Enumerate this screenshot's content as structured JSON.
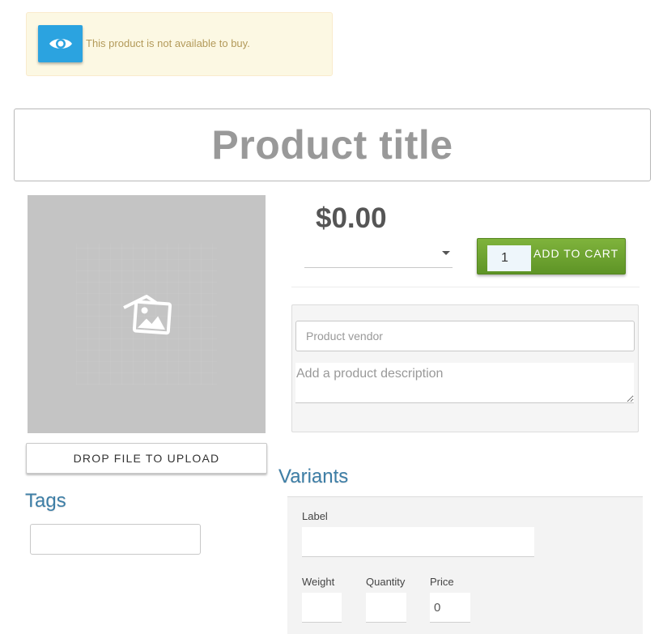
{
  "alert": {
    "icon": "eye-icon",
    "message": "This product is not available to buy."
  },
  "product": {
    "title": "Product title",
    "price": "$0.00",
    "vendor_placeholder": "Product vendor",
    "description_placeholder": "Add a product description"
  },
  "image": {
    "icon": "image-placeholder-icon",
    "upload_label": "DROP FILE TO UPLOAD"
  },
  "cart": {
    "quantity": "1",
    "button_label": "ADD TO CART"
  },
  "tags": {
    "heading": "Tags",
    "value": ""
  },
  "variants": {
    "heading": "Variants",
    "label_label": "Label",
    "label_value": "",
    "weight_label": "Weight",
    "weight_value": "",
    "quantity_label": "Quantity",
    "quantity_value": "",
    "price_label": "Price",
    "price_value": "0"
  },
  "colors": {
    "accent_blue": "#2ba3e0",
    "cart_green": "#6ea431",
    "heading_blue": "#3d7ea6",
    "alert_bg": "#fcf8e3"
  }
}
